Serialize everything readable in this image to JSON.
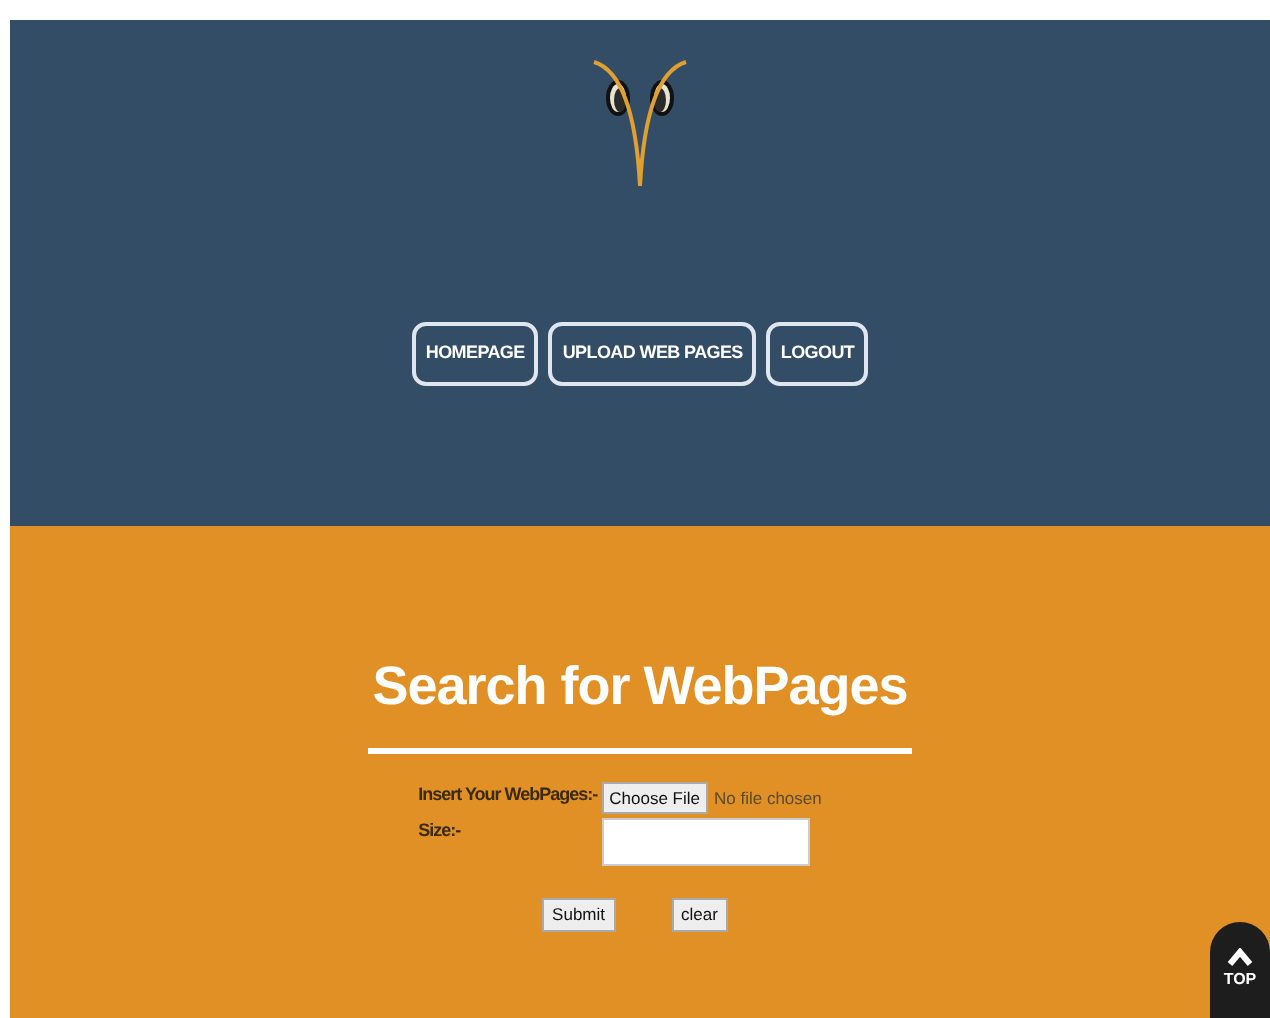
{
  "nav": [
    {
      "label": "HOMEPAGE"
    },
    {
      "label": "UPLOAD WEB PAGES"
    },
    {
      "label": "LOGOUT"
    }
  ],
  "heading": "Search for WebPages",
  "form": {
    "file_label": "Insert Your WebPages:-",
    "file_button": "Choose File",
    "file_status": "No file chosen",
    "size_label": "Size:-",
    "buttons": [
      "Submit",
      "clear"
    ]
  },
  "top_button": "TOP"
}
